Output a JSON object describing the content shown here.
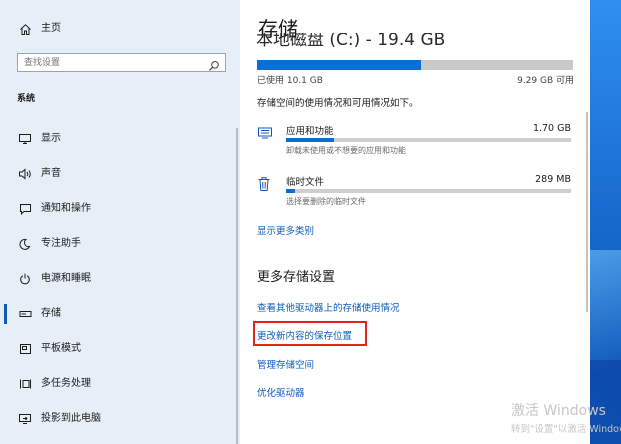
{
  "sidebar": {
    "home_label": "主页",
    "search_placeholder": "查找设置",
    "section_label": "系统",
    "items": [
      {
        "label": "显示",
        "icon": "display-icon"
      },
      {
        "label": "声音",
        "icon": "sound-icon"
      },
      {
        "label": "通知和操作",
        "icon": "notifications-icon"
      },
      {
        "label": "专注助手",
        "icon": "focus-assist-icon"
      },
      {
        "label": "电源和睡眠",
        "icon": "power-icon"
      },
      {
        "label": "存储",
        "icon": "storage-icon",
        "selected": true
      },
      {
        "label": "平板模式",
        "icon": "tablet-mode-icon"
      },
      {
        "label": "多任务处理",
        "icon": "multitasking-icon"
      },
      {
        "label": "投影到此电脑",
        "icon": "project-icon"
      }
    ]
  },
  "content": {
    "title": "存储",
    "drive_heading_partial": "本地磁盘 (C:) - 19.4 GB",
    "used_text": "已使用 10.1 GB",
    "free_text": "9.29 GB 可用",
    "used_fraction": 0.52,
    "description": "存储空间的使用情况和可用情况如下。",
    "categories": [
      {
        "name": "应用和功能",
        "size": "1.70 GB",
        "subtitle": "卸载未使用或不想要的应用和功能",
        "fill_fraction": 0.17,
        "icon": "apps-icon"
      },
      {
        "name": "临时文件",
        "size": "289 MB",
        "subtitle": "选择要删除的临时文件",
        "fill_fraction": 0.03,
        "icon": "trash-icon"
      }
    ],
    "show_more_link": "显示更多类别",
    "more_settings_heading": "更多存储设置",
    "links": [
      "查看其他驱动器上的存储使用情况",
      "更改新内容的保存位置",
      "管理存储空间",
      "优化驱动器"
    ]
  },
  "watermark": {
    "line1": "激活 Windows",
    "line2": "转到\"设置\"以激活 Windows"
  },
  "colors": {
    "accent": "#0b6fd1",
    "link": "#0a5cbd",
    "highlight": "#e32222",
    "sidebar_bg": "#e6eff7"
  }
}
